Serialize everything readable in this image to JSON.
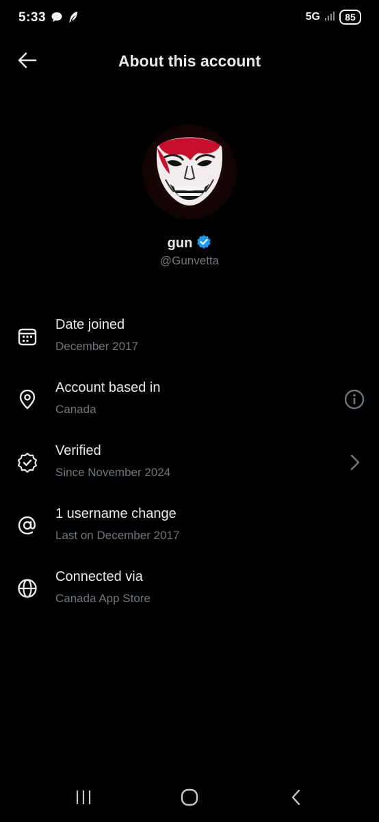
{
  "status_bar": {
    "time": "5:33",
    "network": "5G",
    "battery": "85"
  },
  "header": {
    "title": "About this account",
    "back_icon": "arrow-left-icon"
  },
  "profile": {
    "display_name": "gun",
    "handle": "@Gunvetta",
    "verified_badge_color": "#1d9bf0"
  },
  "info_rows": [
    {
      "icon": "calendar-icon",
      "title": "Date joined",
      "subtitle": "December 2017"
    },
    {
      "icon": "location-pin-icon",
      "title": "Account based in",
      "subtitle": "Canada",
      "action_icon": "info-icon"
    },
    {
      "icon": "verified-badge-icon",
      "title": "Verified",
      "subtitle": "Since November 2024",
      "action_icon": "chevron-right-icon"
    },
    {
      "icon": "at-sign-icon",
      "title": "1 username change",
      "subtitle": "Last on December 2017"
    },
    {
      "icon": "globe-icon",
      "title": "Connected via",
      "subtitle": "Canada App Store"
    }
  ],
  "nav_bar": {
    "recents_icon": "recents-icon",
    "home_icon": "home-icon",
    "back_icon": "back-chevron-icon"
  },
  "colors": {
    "background": "#000000",
    "primary_text": "#e7e9ea",
    "secondary_text": "#71767b",
    "accent_blue": "#1d9bf0"
  }
}
